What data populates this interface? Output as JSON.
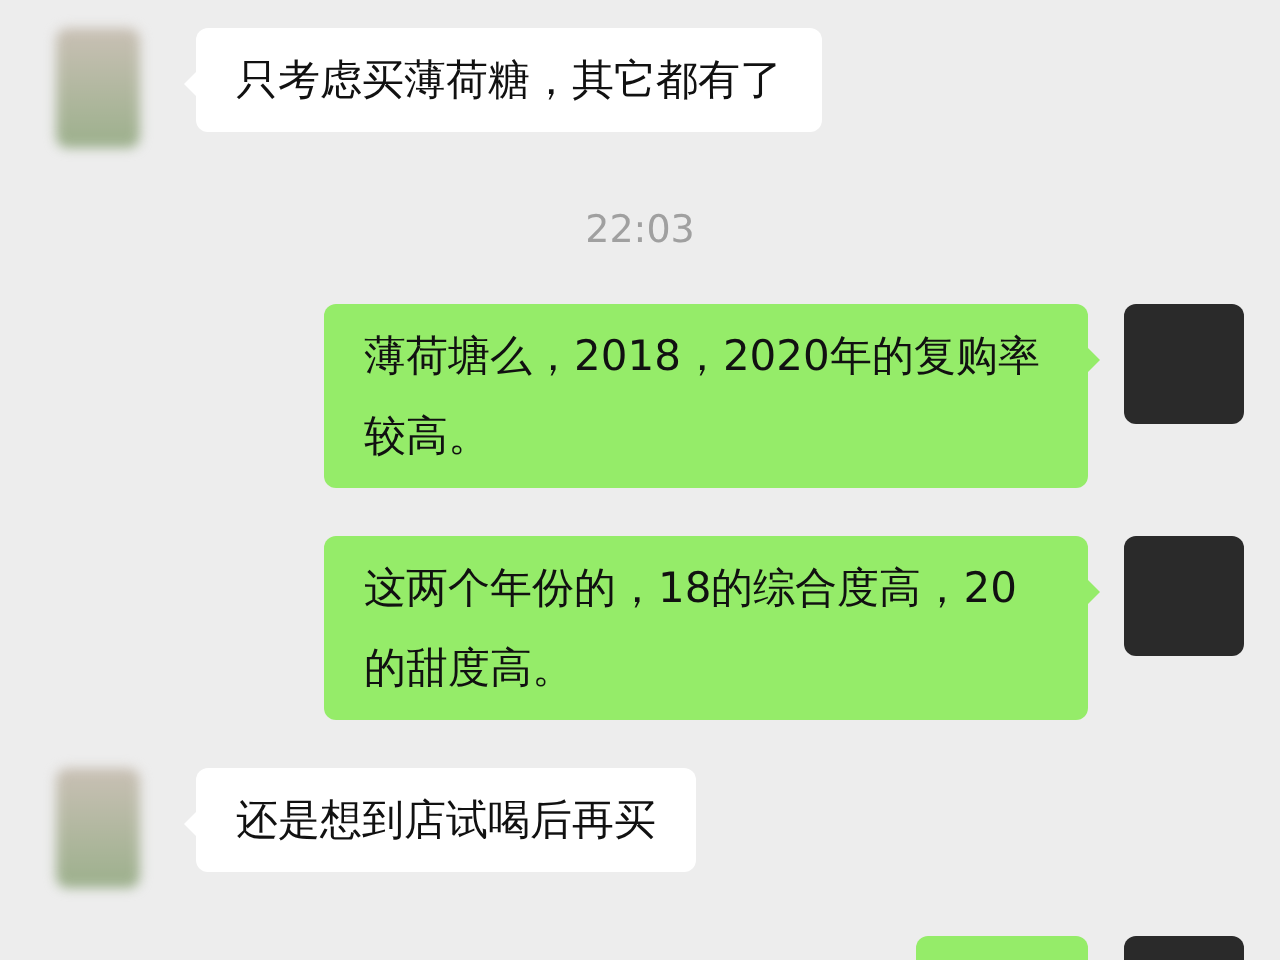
{
  "messages": [
    {
      "kind": "received",
      "text": "只考虑买薄荷糖，其它都有了"
    },
    {
      "kind": "time",
      "text": "22:03"
    },
    {
      "kind": "sent",
      "text": "薄荷塘么，2018，2020年的复购率较高。"
    },
    {
      "kind": "sent",
      "text": "这两个年份的，18的综合度高，20的甜度高。"
    },
    {
      "kind": "received",
      "text": "还是想到店试喝后再买"
    },
    {
      "kind": "sent"
    }
  ]
}
